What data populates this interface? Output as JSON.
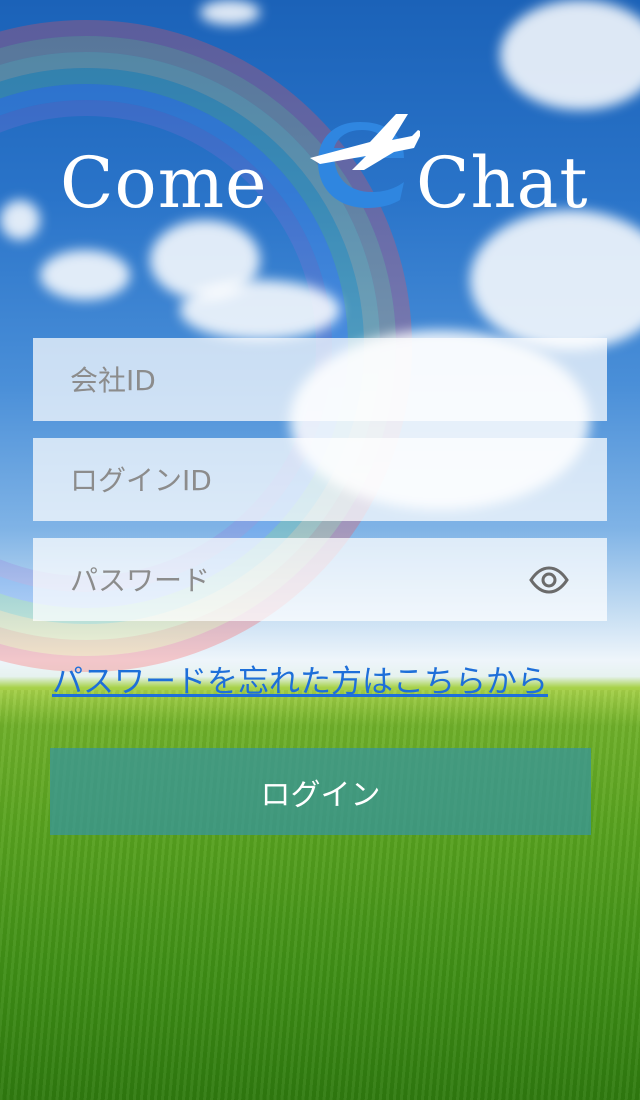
{
  "app": {
    "logo_left": "Come",
    "logo_right": "Chat"
  },
  "form": {
    "company_id_placeholder": "会社ID",
    "login_id_placeholder": "ログインID",
    "password_placeholder": "パスワード",
    "forgot_password_link": "パスワードを忘れた方はこちらから",
    "login_button": "ログイン"
  },
  "icons": {
    "password_toggle": "eye-icon",
    "logo_mark": "airplane-e-icon"
  },
  "colors": {
    "link": "#1e6fd9",
    "login_button": "#3a9696",
    "logo_accent": "#2f86e0"
  }
}
